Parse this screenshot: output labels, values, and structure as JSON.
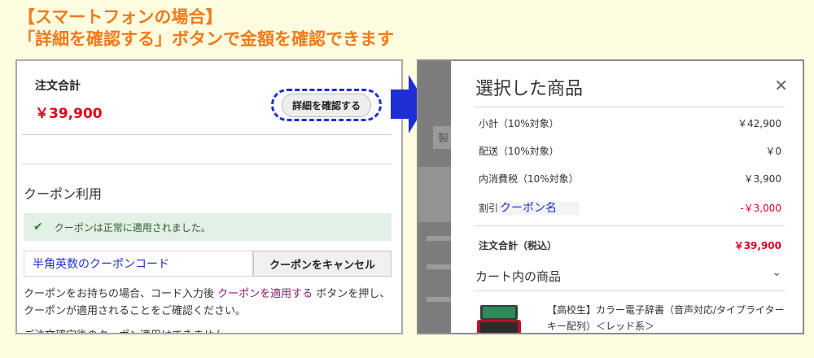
{
  "heading": {
    "line1": "【スマートフォンの場合】",
    "line2": "「詳細を確認する」ボタンで金額を確認できます"
  },
  "left": {
    "total_label": "注文合計",
    "total_amount": "￥39,900",
    "details_button": "詳細を確認する",
    "coupon_title": "クーポン利用",
    "success_message": "クーポンは正常に適用されました。",
    "coupon_input_value": "半角英数のクーポンコード",
    "cancel_button": "クーポンをキャンセル",
    "help_before": "クーポンをお持ちの場合、コード入力後 ",
    "help_link": "クーポンを適用する",
    "help_after": " ボタンを押し、クーポンが適用されることをご確認ください。",
    "note": "ご注文確定後のクーポン適用はできません。"
  },
  "right": {
    "background_label": "製",
    "modal_title": "選択した商品",
    "rows": [
      {
        "label": "小計（10%対象）",
        "value": "￥42,900"
      },
      {
        "label": "配送（10%対象）",
        "value": "￥0"
      },
      {
        "label": "内消費税（10%対象）",
        "value": "￥3,900"
      }
    ],
    "discount_label": "割引",
    "coupon_name": "クーポン名",
    "discount_value": "-￥3,000",
    "total_label": "注文合計（税込）",
    "total_value": "￥39,900",
    "cart_title": "カート内の商品",
    "product_name": "【高校生】カラー電子辞書（音声対応/タイプライターキー配列）＜レッド系＞"
  },
  "colors": {
    "accent_orange": "#f27a1a",
    "price_red": "#e3001b",
    "highlight_blue": "#1f2fd6"
  }
}
